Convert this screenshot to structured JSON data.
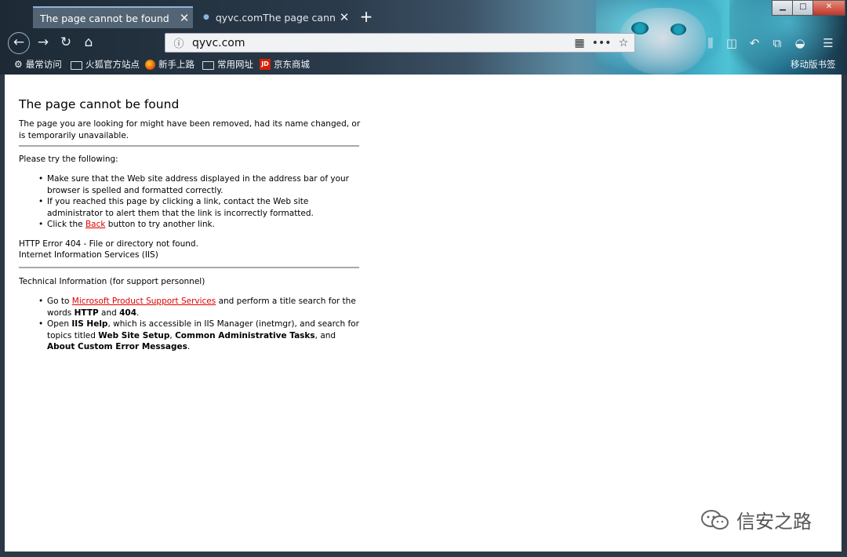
{
  "tabs": [
    {
      "title": "The page cannot be found",
      "active": true
    },
    {
      "title": "qyvc.comThe page cannot be found",
      "active": false
    }
  ],
  "window_controls": {
    "minimize": "▁",
    "maximize": "□",
    "close": "✕"
  },
  "toolbar": {
    "url": "qyvc.com",
    "icons": [
      "back-icon",
      "forward-icon",
      "reload-icon",
      "home-icon",
      "info-icon",
      "qr-code-icon",
      "more-icon",
      "star-icon",
      "library-icon",
      "sidebar-icon",
      "undo-icon",
      "screenshot-icon",
      "mask-icon",
      "menu-icon"
    ]
  },
  "bookmarks": {
    "items": [
      "最常访问",
      "火狐官方站点",
      "新手上路",
      "常用网址",
      "京东商城"
    ],
    "mobile": "移动版书签"
  },
  "page": {
    "heading": "The page cannot be found",
    "intro": "The page you are looking for might have been removed, had its name changed, or is temporarily unavailable.",
    "try_heading": "Please try the following:",
    "try_items": [
      "Make sure that the Web site address displayed in the address bar of your browser is spelled and formatted correctly.",
      "If you reached this page by clicking a link, contact the Web site administrator to alert them that the link is incorrectly formatted."
    ],
    "back_item": {
      "pre": "Click the ",
      "link": "Back",
      "post": " button to try another link."
    },
    "error_line1": "HTTP Error 404 - File or directory not found.",
    "error_line2": "Internet Information Services (IIS)",
    "tech_heading": "Technical Information (for support personnel)",
    "tech_item1": {
      "pre": "Go to ",
      "link": "Microsoft Product Support Services",
      "mid": " and perform a title search for the words ",
      "b1": "HTTP",
      "and": " and ",
      "b2": "404",
      "end": "."
    },
    "tech_item2": {
      "pre": "Open ",
      "b1": "IIS Help",
      "mid": ", which is accessible in IIS Manager (inetmgr), and search for topics titled ",
      "b2": "Web Site Setup",
      "sep1": ", ",
      "b3": "Common Administrative Tasks",
      "sep2": ", and ",
      "b4": "About Custom Error Messages",
      "end": "."
    }
  },
  "watermark": "信安之路"
}
